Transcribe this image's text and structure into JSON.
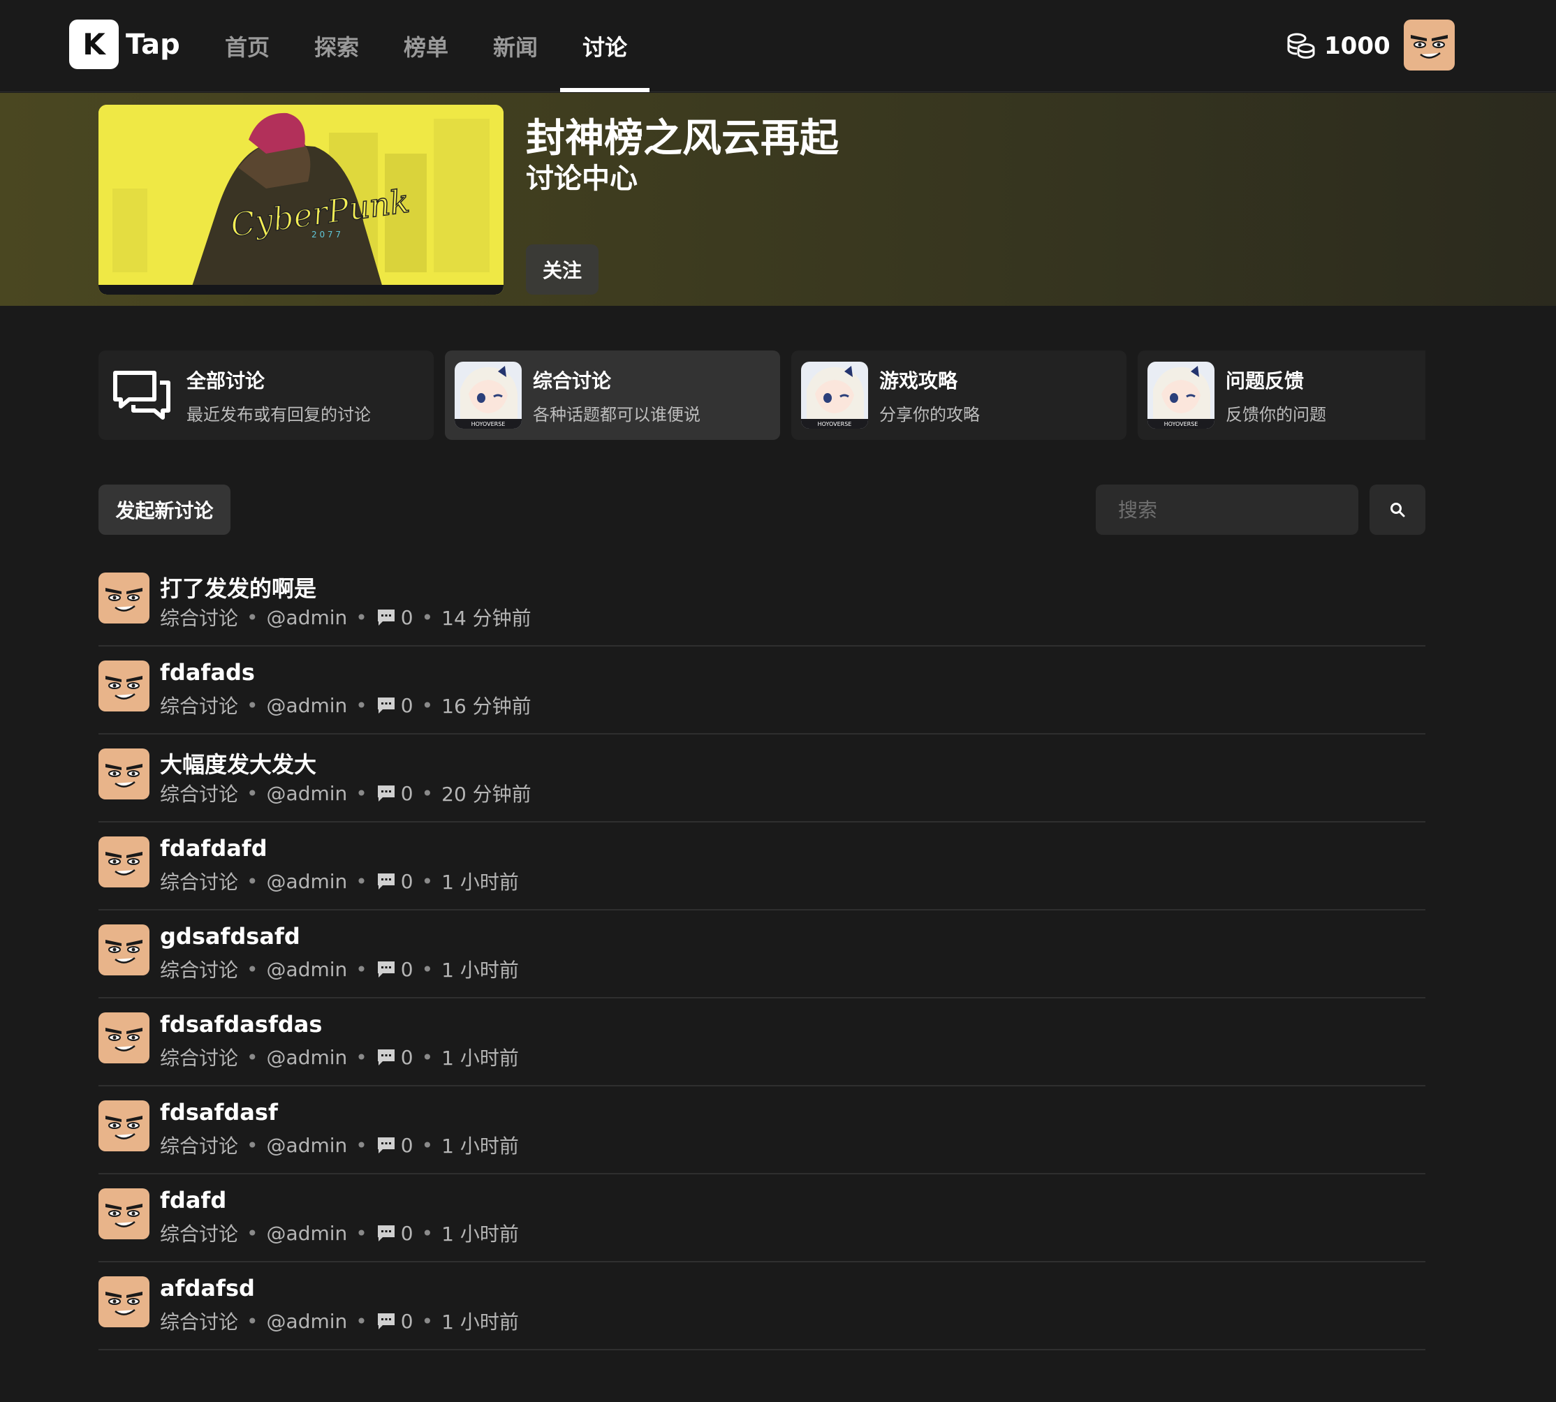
{
  "header": {
    "logo_letter": "K",
    "logo_text": "Tap",
    "nav": [
      {
        "label": "首页"
      },
      {
        "label": "探索"
      },
      {
        "label": "榜单"
      },
      {
        "label": "新闻"
      },
      {
        "label": "讨论"
      }
    ],
    "active_nav": "讨论",
    "coins": "1000"
  },
  "hero": {
    "cover_text": "CyberPunk",
    "cover_subtext": "2 0 7 7",
    "title": "封神榜之风云再起",
    "subtitle": "讨论中心",
    "follow_label": "关注"
  },
  "categories": [
    {
      "name": "全部讨论",
      "desc": "最近发布或有回复的讨论",
      "icon": "chat-bubbles-icon"
    },
    {
      "name": "综合讨论",
      "desc": "各种话题都可以谁便说",
      "icon": "game-character-icon",
      "badge": "HOYOVERSE"
    },
    {
      "name": "游戏攻略",
      "desc": "分享你的攻略",
      "icon": "game-character-icon",
      "badge": "HOYOVERSE"
    },
    {
      "name": "问题反馈",
      "desc": "反馈你的问题",
      "icon": "game-character-icon",
      "badge": "HOYOVERSE"
    }
  ],
  "toolbar": {
    "new_label": "发起新讨论",
    "search_placeholder": "搜索"
  },
  "discussions": [
    {
      "title": "打了发发的啊是",
      "category": "综合讨论",
      "user": "@admin",
      "comments": "0",
      "time": "14 分钟前"
    },
    {
      "title": "fdafads",
      "category": "综合讨论",
      "user": "@admin",
      "comments": "0",
      "time": "16 分钟前"
    },
    {
      "title": "大幅度发大发大",
      "category": "综合讨论",
      "user": "@admin",
      "comments": "0",
      "time": "20 分钟前"
    },
    {
      "title": "fdafdafd",
      "category": "综合讨论",
      "user": "@admin",
      "comments": "0",
      "time": "1 小时前"
    },
    {
      "title": "gdsafdsafd",
      "category": "综合讨论",
      "user": "@admin",
      "comments": "0",
      "time": "1 小时前"
    },
    {
      "title": "fdsafdasfdas",
      "category": "综合讨论",
      "user": "@admin",
      "comments": "0",
      "time": "1 小时前"
    },
    {
      "title": "fdsafdasf",
      "category": "综合讨论",
      "user": "@admin",
      "comments": "0",
      "time": "1 小时前"
    },
    {
      "title": "fdafd",
      "category": "综合讨论",
      "user": "@admin",
      "comments": "0",
      "time": "1 小时前"
    },
    {
      "title": "afdafsd",
      "category": "综合讨论",
      "user": "@admin",
      "comments": "0",
      "time": "1 小时前"
    }
  ],
  "colors": {
    "background": "#1a1a1a",
    "hero_tint": "#4a4721",
    "avatar_skin": "#e8b48a"
  }
}
